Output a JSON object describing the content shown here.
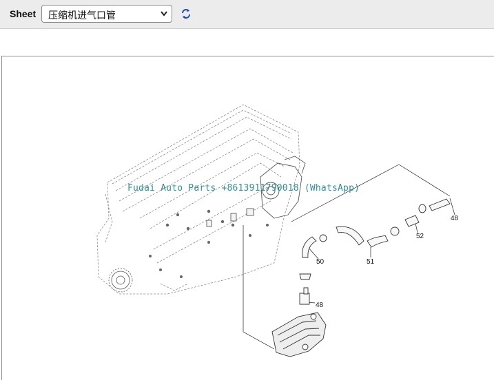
{
  "toolbar": {
    "sheet_label": "Sheet",
    "sheet_selected": "压缩机进气口管",
    "refresh_icon": "refresh-icon"
  },
  "diagram": {
    "watermark": "Fudai Auto Parts +8613911790018 (WhatsApp)",
    "callouts": [
      "48",
      "52",
      "50",
      "51",
      "48"
    ]
  }
}
